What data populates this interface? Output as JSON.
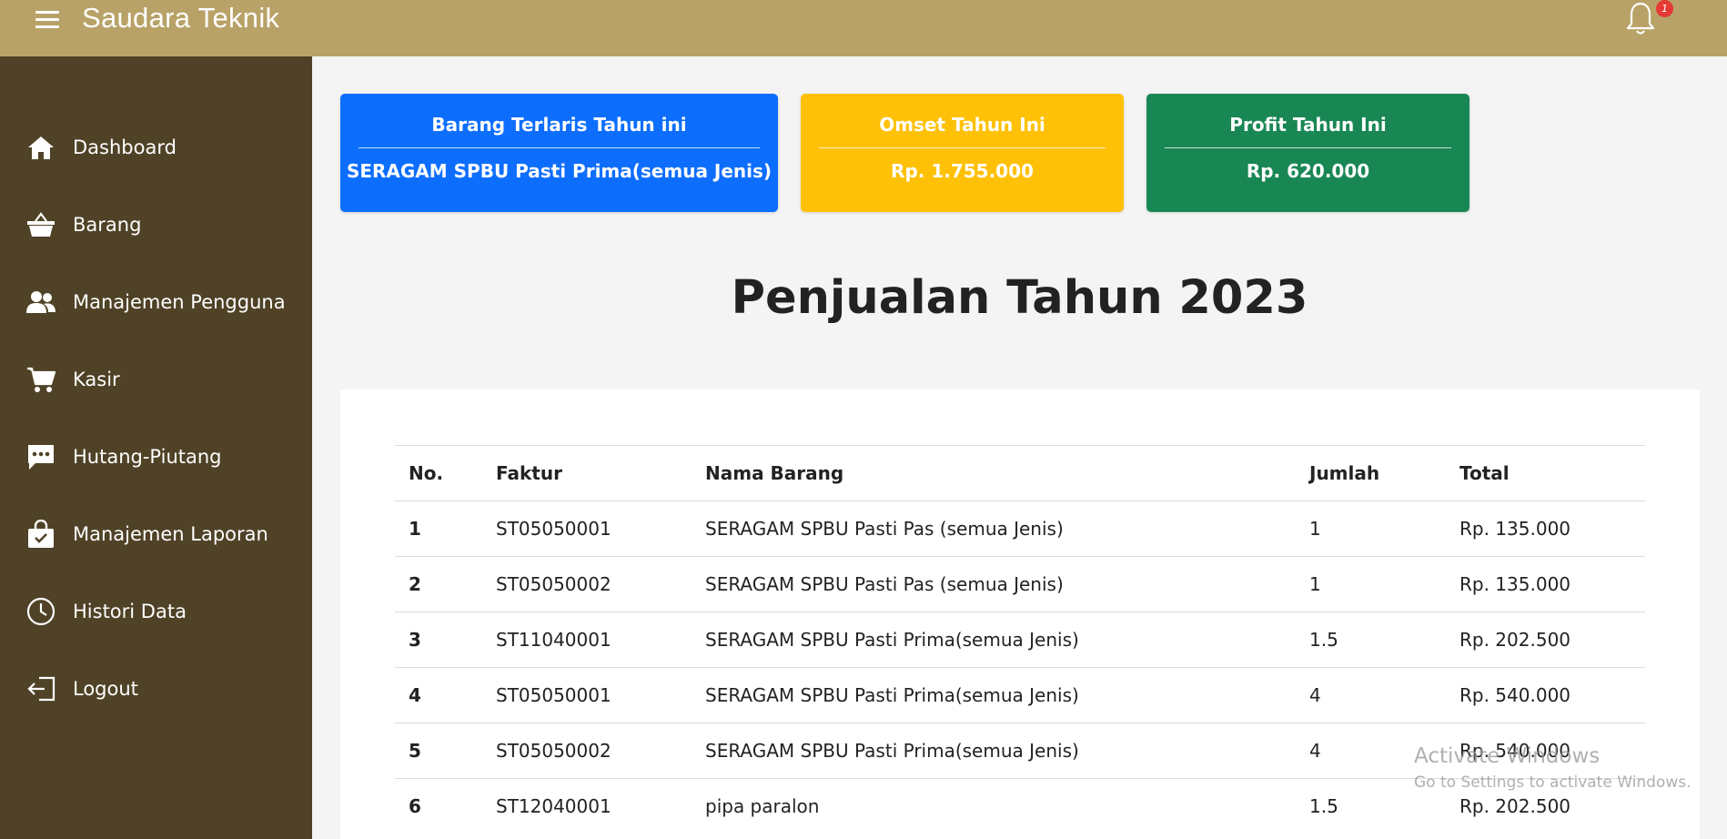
{
  "header": {
    "brand": "Saudara Teknik",
    "notification_count": "1"
  },
  "sidebar": {
    "items": [
      {
        "label": "Dashboard",
        "icon": "home-icon"
      },
      {
        "label": "Barang",
        "icon": "basket-icon"
      },
      {
        "label": "Manajemen Pengguna",
        "icon": "users-icon"
      },
      {
        "label": "Kasir",
        "icon": "cart-icon"
      },
      {
        "label": "Hutang-Piutang",
        "icon": "chat-icon"
      },
      {
        "label": "Manajemen Laporan",
        "icon": "bag-check-icon"
      },
      {
        "label": "Histori Data",
        "icon": "clock-icon"
      },
      {
        "label": "Logout",
        "icon": "logout-icon"
      }
    ]
  },
  "cards": [
    {
      "title": "Barang Terlaris Tahun ini",
      "value": "SERAGAM SPBU Pasti Prima(semua Jenis)",
      "color": "#0d6efd"
    },
    {
      "title": "Omset Tahun Ini",
      "value": "Rp. 1.755.000",
      "color": "#ffc107"
    },
    {
      "title": "Profit Tahun Ini",
      "value": "Rp. 620.000",
      "color": "#198754"
    }
  ],
  "section_title": "Penjualan Tahun 2023",
  "table": {
    "headers": [
      "No.",
      "Faktur",
      "Nama Barang",
      "Jumlah",
      "Total"
    ],
    "rows": [
      [
        "1",
        "ST05050001",
        "SERAGAM SPBU Pasti Pas (semua Jenis)",
        "1",
        "Rp. 135.000"
      ],
      [
        "2",
        "ST05050002",
        "SERAGAM SPBU Pasti Pas (semua Jenis)",
        "1",
        "Rp. 135.000"
      ],
      [
        "3",
        "ST11040001",
        "SERAGAM SPBU Pasti Prima(semua Jenis)",
        "1.5",
        "Rp. 202.500"
      ],
      [
        "4",
        "ST05050001",
        "SERAGAM SPBU Pasti Prima(semua Jenis)",
        "4",
        "Rp. 540.000"
      ],
      [
        "5",
        "ST05050002",
        "SERAGAM SPBU Pasti Prima(semua Jenis)",
        "4",
        "Rp. 540.000"
      ],
      [
        "6",
        "ST12040001",
        "pipa paralon",
        "1.5",
        "Rp. 202.500"
      ]
    ]
  },
  "watermark": {
    "line1": "Activate Windows",
    "line2": "Go to Settings to activate Windows."
  }
}
